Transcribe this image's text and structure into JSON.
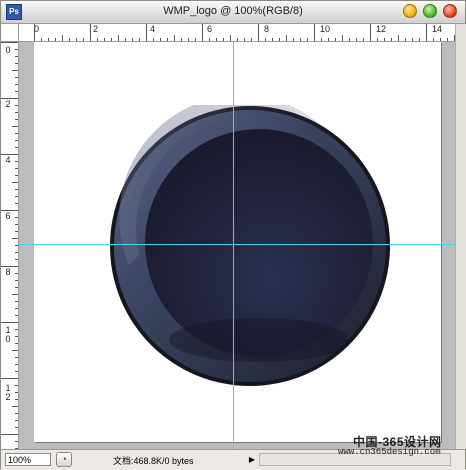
{
  "window": {
    "title": "WMP_logo @ 100%(RGB/8)",
    "app_icon": "Ps"
  },
  "rulers": {
    "horizontal_labels": [
      "0",
      "2",
      "4",
      "6",
      "8",
      "10",
      "12",
      "14"
    ],
    "vertical_labels": [
      "0",
      "2",
      "4",
      "6",
      "8",
      "10",
      "12"
    ]
  },
  "status": {
    "zoom": "100%",
    "doc_size": "文档:468.8K/0 bytes"
  },
  "watermark": {
    "site_cn": "中国-365设计网",
    "url": "www.cn365design.com"
  },
  "colors": {
    "guide": "#3fd6e8",
    "logo_rim": "#1a1b26",
    "logo_ring": "#3e4866",
    "logo_core": "#23243a"
  },
  "icons": {
    "navigator": "navigator-icon",
    "scroll_right": "triangle-right-icon"
  }
}
